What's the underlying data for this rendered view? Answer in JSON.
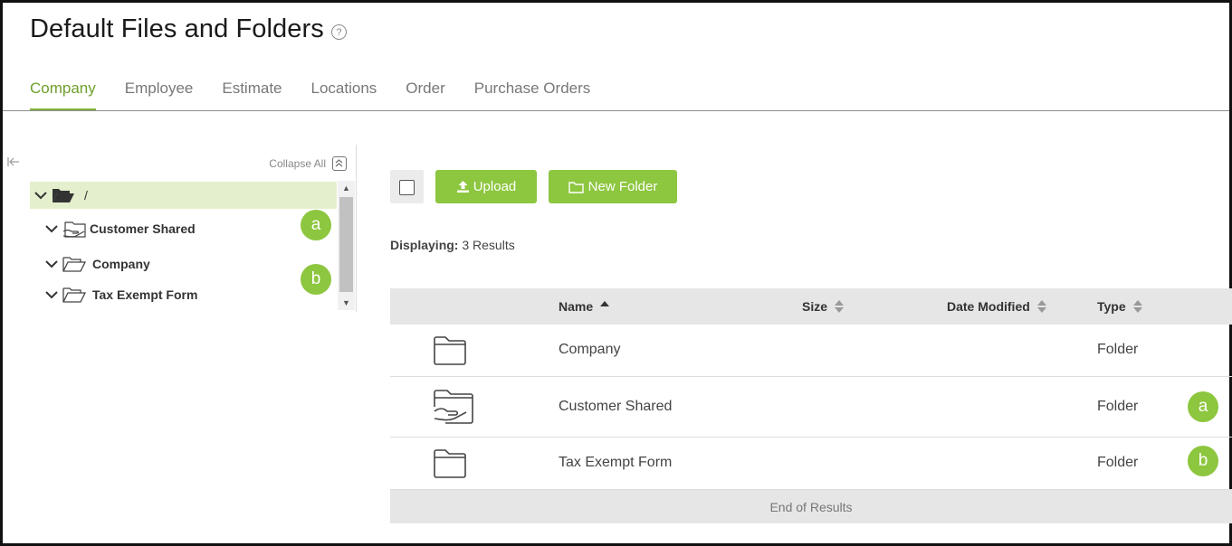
{
  "page": {
    "title": "Default Files and Folders",
    "help_glyph": "?"
  },
  "tabs": [
    {
      "label": "Company",
      "active": true
    },
    {
      "label": "Employee",
      "active": false
    },
    {
      "label": "Estimate",
      "active": false
    },
    {
      "label": "Locations",
      "active": false
    },
    {
      "label": "Order",
      "active": false
    },
    {
      "label": "Purchase Orders",
      "active": false
    }
  ],
  "tree": {
    "collapse_all_label": "Collapse All",
    "root_label": "/",
    "items": [
      {
        "label": "Customer Shared",
        "icon": "shared-folder-icon"
      },
      {
        "label": "Company",
        "icon": "folder-icon"
      },
      {
        "label": "Tax Exempt Form",
        "icon": "folder-icon"
      }
    ]
  },
  "toolbar": {
    "upload_label": "Upload",
    "new_folder_label": "New Folder"
  },
  "results": {
    "displaying_label": "Displaying:",
    "count_text": "3 Results"
  },
  "table": {
    "columns": {
      "name": "Name",
      "size": "Size",
      "date_modified": "Date Modified",
      "type": "Type"
    },
    "rows": [
      {
        "name": "Company",
        "size": "",
        "date_modified": "",
        "type": "Folder",
        "icon": "folder-icon"
      },
      {
        "name": "Customer Shared",
        "size": "",
        "date_modified": "",
        "type": "Folder",
        "icon": "shared-folder-icon"
      },
      {
        "name": "Tax Exempt Form",
        "size": "",
        "date_modified": "",
        "type": "Folder",
        "icon": "folder-icon"
      }
    ],
    "footer": "End of Results"
  },
  "badges": {
    "a": "a",
    "b": "b"
  },
  "colors": {
    "accent": "#8dc63f",
    "active_tab": "#6f9e2c",
    "selected_row": "#e4f0cd"
  }
}
